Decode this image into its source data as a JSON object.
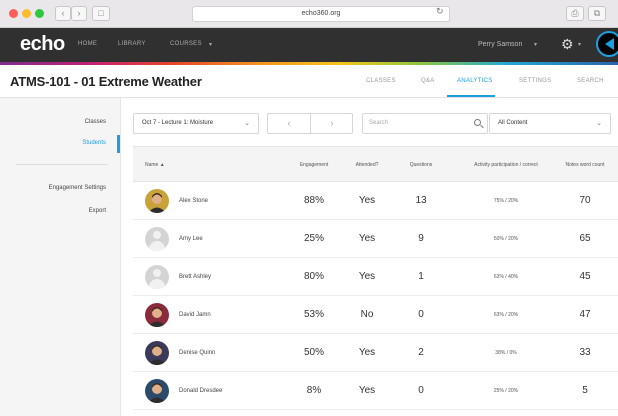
{
  "browser": {
    "back_label": "‹",
    "forward_label": "›",
    "sidebar_btn_label": "□",
    "url": "echo360.org",
    "reload_label": "↻",
    "share_label": "⎙",
    "tabs_label": "⧉"
  },
  "app": {
    "logo": "echo",
    "nav": [
      "HOME",
      "LIBRARY",
      "COURSES"
    ],
    "courses_caret": "▾",
    "user": "Perry Samson",
    "user_caret": "▾",
    "gear_glyph": "⚙",
    "gear_caret": "▾",
    "accent": "#1aa0e0"
  },
  "course": {
    "title": "ATMS-101 - 01 Extreme Weather",
    "tabs": [
      "CLASSES",
      "Q&A",
      "ANALYTICS",
      "SETTINGS",
      "SEARCH"
    ],
    "active_tab": "ANALYTICS"
  },
  "sidebar": {
    "items": [
      "Classes",
      "Students",
      "Engagement Settings",
      "Export"
    ],
    "active": "Students"
  },
  "filters": {
    "lecture": "Oct 7 - Lecture 1: Moisture",
    "lecture_caret": "⌄",
    "prev": "‹",
    "next": "›",
    "search_placeholder": "Search",
    "content": "All Content",
    "content_caret": "⌄"
  },
  "table": {
    "headers": {
      "name": "Name ▲",
      "engagement": "Engagement",
      "attended": "Attended?",
      "questions": "Questions",
      "activity": "Activity participation / correct",
      "notes": "Notes word count"
    },
    "rows": [
      {
        "name": "Alex Stone",
        "engagement": "88%",
        "attended": "Yes",
        "questions": "13",
        "activity": "75% / 20%",
        "notes": "70",
        "avatar": "photo"
      },
      {
        "name": "Amy Lee",
        "engagement": "25%",
        "attended": "Yes",
        "questions": "9",
        "activity": "50% / 20%",
        "notes": "65",
        "avatar": "placeholder"
      },
      {
        "name": "Brett Ashley",
        "engagement": "80%",
        "attended": "Yes",
        "questions": "1",
        "activity": "63% / 40%",
        "notes": "45",
        "avatar": "placeholder"
      },
      {
        "name": "David Jamn",
        "engagement": "53%",
        "attended": "No",
        "questions": "0",
        "activity": "63% / 20%",
        "notes": "47",
        "avatar": "photo"
      },
      {
        "name": "Denise Quinn",
        "engagement": "50%",
        "attended": "Yes",
        "questions": "2",
        "activity": "38% / 0%",
        "notes": "33",
        "avatar": "photo"
      },
      {
        "name": "Donald Dresdee",
        "engagement": "8%",
        "attended": "Yes",
        "questions": "0",
        "activity": "25% / 20%",
        "notes": "5",
        "avatar": "photo"
      }
    ]
  }
}
